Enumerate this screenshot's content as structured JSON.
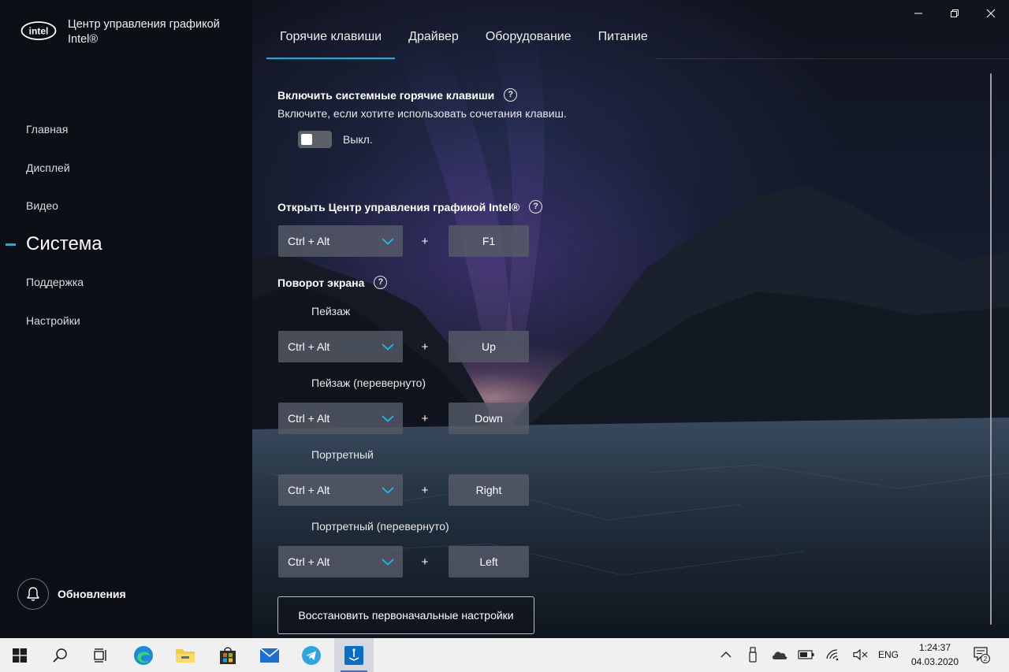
{
  "app": {
    "brand_line1": "Центр управления графикой",
    "brand_line2": "Intel®",
    "logo_text": "intel",
    "accent_color": "#00b7e8"
  },
  "sidebar": {
    "items": [
      {
        "label": "Главная",
        "active": false
      },
      {
        "label": "Дисплей",
        "active": false
      },
      {
        "label": "Видео",
        "active": false
      },
      {
        "label": "Система",
        "active": true
      },
      {
        "label": "Поддержка",
        "active": false
      },
      {
        "label": "Настройки",
        "active": false
      }
    ],
    "updates_label": "Обновления"
  },
  "tabs": [
    {
      "label": "Горячие клавиши",
      "active": true
    },
    {
      "label": "Драйвер",
      "active": false
    },
    {
      "label": "Оборудование",
      "active": false
    },
    {
      "label": "Питание",
      "active": false
    }
  ],
  "hotkeys": {
    "enable": {
      "title": "Включить системные горячие клавиши",
      "help": "?",
      "description": "Включите, если хотите использовать сочетания клавиш.",
      "toggle_state": "Выкл.",
      "toggle_on": false
    },
    "open_center": {
      "title": "Открыть Центр управления графикой Intel®",
      "help": "?",
      "modifier": "Ctrl + Alt",
      "plus": "+",
      "key": "F1"
    },
    "rotation": {
      "title": "Поворот экрана",
      "help": "?",
      "items": [
        {
          "label": "Пейзаж",
          "modifier": "Ctrl + Alt",
          "plus": "+",
          "key": "Up"
        },
        {
          "label": "Пейзаж (перевернуто)",
          "modifier": "Ctrl + Alt",
          "plus": "+",
          "key": "Down"
        },
        {
          "label": "Портретный",
          "modifier": "Ctrl + Alt",
          "plus": "+",
          "key": "Right"
        },
        {
          "label": "Портретный (перевернуто)",
          "modifier": "Ctrl + Alt",
          "plus": "+",
          "key": "Left"
        }
      ]
    },
    "restore_label": "Восстановить первоначальные настройки"
  },
  "taskbar": {
    "apps": [
      "start-icon",
      "search-icon",
      "task-view-icon",
      "edge-icon",
      "file-explorer-icon",
      "store-icon",
      "mail-icon",
      "telegram-icon",
      "intel-graphics-icon"
    ],
    "tray": [
      "chevron-up-icon",
      "usb-icon",
      "onedrive-icon",
      "battery-icon",
      "wifi-icon",
      "volume-muted-icon"
    ],
    "language": "ENG",
    "time": "1:24:37",
    "date": "04.03.2020",
    "notification_count": "2"
  }
}
